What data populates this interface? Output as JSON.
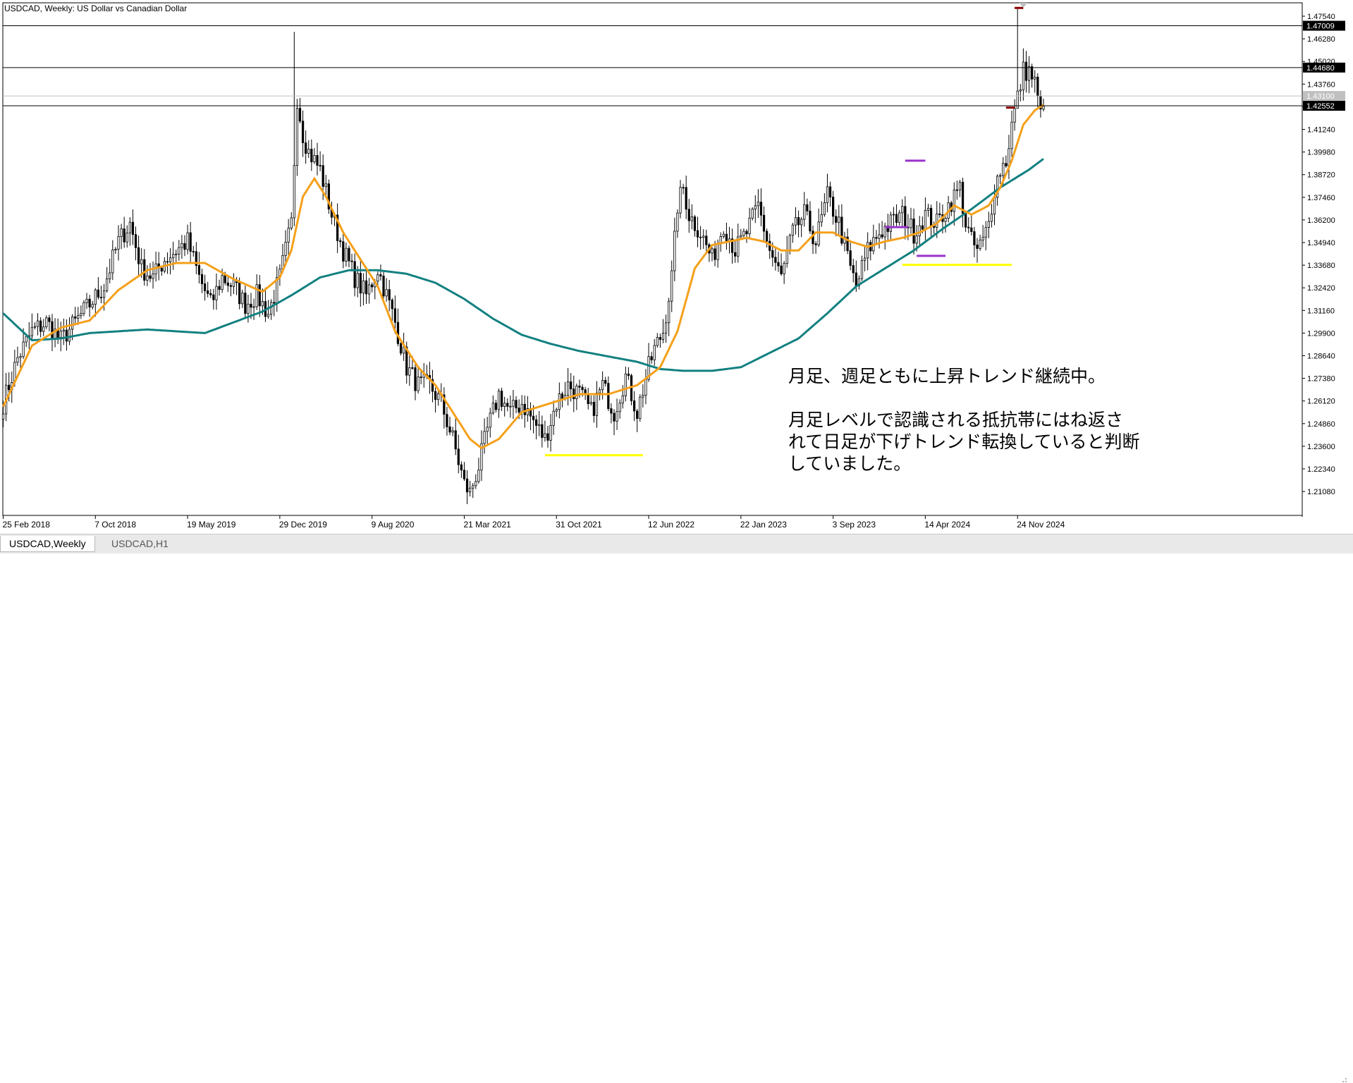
{
  "window": {
    "title": "USDCAD, Weekly:  US Dollar vs Canadian Dollar"
  },
  "tabs": [
    {
      "label": "USDCAD,Weekly",
      "active": true
    },
    {
      "label": "USDCAD,H1",
      "active": false
    }
  ],
  "annotation": {
    "line1": "月足、週足ともに上昇トレンド継続中。",
    "line2": "月足レベルで認識される抵抗帯にはね返さ",
    "line3": "れて日足が下げトレンド転換していると判断",
    "line4": "していました。"
  },
  "colors": {
    "bull_bear_candles": "#000000",
    "ma_fast": "#f5a01a",
    "ma_slow": "#128080",
    "marker_yellow": "#ffff00",
    "marker_purple": "#9932cc",
    "marker_darkred": "#8b0000",
    "price_label_bg": "#000000",
    "current_price_label_bg": "#c0c0c0"
  },
  "chart_data": {
    "type": "candlestick",
    "symbol": "USDCAD",
    "timeframe": "Weekly",
    "ylim": [
      1.1975,
      1.48285
    ],
    "y_ticks": [
      "1.47540",
      "1.46280",
      "1.45020",
      "1.43760",
      "1.42500",
      "1.41240",
      "1.39980",
      "1.38720",
      "1.37460",
      "1.36200",
      "1.34940",
      "1.33680",
      "1.32420",
      "1.31160",
      "1.29900",
      "1.28640",
      "1.27380",
      "1.26120",
      "1.24860",
      "1.23600",
      "1.22340",
      "1.21080"
    ],
    "x_ticks": [
      "25 Feb 2018",
      "7 Oct 2018",
      "19 May 2019",
      "29 Dec 2019",
      "9 Aug 2020",
      "21 Mar 2021",
      "31 Oct 2021",
      "12 Jun 2022",
      "22 Jan 2023",
      "3 Sep 2023",
      "14 Apr 2024",
      "24 Nov 2024"
    ],
    "x_tick_index": [
      0,
      32,
      64,
      96,
      128,
      160,
      192,
      224,
      256,
      288,
      320,
      352
    ],
    "n_bars": 362,
    "horizontal_lines": [
      {
        "price": 1.47009,
        "label": "1.47009"
      },
      {
        "price": 1.4468,
        "label": "1.44680"
      },
      {
        "price": 1.42552,
        "label": "1.42552"
      }
    ],
    "current_price": {
      "price": 1.431,
      "label": "1.43100"
    },
    "keypoints_close": [
      [
        0,
        1.26
      ],
      [
        5,
        1.285
      ],
      [
        10,
        1.3
      ],
      [
        15,
        1.305
      ],
      [
        20,
        1.295
      ],
      [
        25,
        1.305
      ],
      [
        30,
        1.315
      ],
      [
        35,
        1.325
      ],
      [
        40,
        1.35
      ],
      [
        44,
        1.36
      ],
      [
        48,
        1.335
      ],
      [
        52,
        1.33
      ],
      [
        56,
        1.34
      ],
      [
        60,
        1.345
      ],
      [
        64,
        1.35
      ],
      [
        68,
        1.33
      ],
      [
        72,
        1.315
      ],
      [
        76,
        1.33
      ],
      [
        80,
        1.325
      ],
      [
        84,
        1.315
      ],
      [
        88,
        1.32
      ],
      [
        92,
        1.31
      ],
      [
        96,
        1.33
      ],
      [
        98,
        1.345
      ],
      [
        100,
        1.36
      ],
      [
        102,
        1.43
      ],
      [
        104,
        1.41
      ],
      [
        106,
        1.4
      ],
      [
        110,
        1.39
      ],
      [
        114,
        1.365
      ],
      [
        118,
        1.345
      ],
      [
        122,
        1.33
      ],
      [
        126,
        1.32
      ],
      [
        130,
        1.335
      ],
      [
        134,
        1.315
      ],
      [
        136,
        1.305
      ],
      [
        140,
        1.28
      ],
      [
        144,
        1.27
      ],
      [
        148,
        1.27
      ],
      [
        152,
        1.26
      ],
      [
        156,
        1.24
      ],
      [
        160,
        1.215
      ],
      [
        162,
        1.21
      ],
      [
        165,
        1.225
      ],
      [
        168,
        1.245
      ],
      [
        172,
        1.265
      ],
      [
        176,
        1.255
      ],
      [
        180,
        1.26
      ],
      [
        184,
        1.25
      ],
      [
        188,
        1.24
      ],
      [
        192,
        1.26
      ],
      [
        196,
        1.27
      ],
      [
        200,
        1.265
      ],
      [
        204,
        1.255
      ],
      [
        208,
        1.27
      ],
      [
        212,
        1.255
      ],
      [
        216,
        1.275
      ],
      [
        220,
        1.255
      ],
      [
        224,
        1.28
      ],
      [
        226,
        1.29
      ],
      [
        229,
        1.3
      ],
      [
        232,
        1.33
      ],
      [
        234,
        1.37
      ],
      [
        236,
        1.38
      ],
      [
        238,
        1.365
      ],
      [
        242,
        1.355
      ],
      [
        246,
        1.34
      ],
      [
        250,
        1.36
      ],
      [
        254,
        1.345
      ],
      [
        258,
        1.355
      ],
      [
        262,
        1.37
      ],
      [
        266,
        1.345
      ],
      [
        270,
        1.33
      ],
      [
        274,
        1.355
      ],
      [
        278,
        1.365
      ],
      [
        282,
        1.35
      ],
      [
        286,
        1.375
      ],
      [
        290,
        1.36
      ],
      [
        294,
        1.335
      ],
      [
        296,
        1.325
      ],
      [
        300,
        1.345
      ],
      [
        304,
        1.355
      ],
      [
        308,
        1.36
      ],
      [
        312,
        1.365
      ],
      [
        316,
        1.355
      ],
      [
        320,
        1.365
      ],
      [
        324,
        1.36
      ],
      [
        328,
        1.37
      ],
      [
        332,
        1.38
      ],
      [
        334,
        1.36
      ],
      [
        336,
        1.35
      ],
      [
        338,
        1.345
      ],
      [
        340,
        1.35
      ],
      [
        342,
        1.36
      ],
      [
        344,
        1.38
      ],
      [
        346,
        1.39
      ],
      [
        348,
        1.395
      ],
      [
        350,
        1.415
      ],
      [
        352,
        1.43
      ],
      [
        354,
        1.445
      ],
      [
        356,
        1.445
      ],
      [
        358,
        1.438
      ],
      [
        360,
        1.42
      ],
      [
        361,
        1.43
      ]
    ],
    "ma_fast_keypoints": [
      [
        0,
        1.258
      ],
      [
        10,
        1.292
      ],
      [
        20,
        1.302
      ],
      [
        30,
        1.306
      ],
      [
        40,
        1.323
      ],
      [
        50,
        1.334
      ],
      [
        60,
        1.338
      ],
      [
        70,
        1.338
      ],
      [
        80,
        1.329
      ],
      [
        90,
        1.322
      ],
      [
        96,
        1.33
      ],
      [
        100,
        1.345
      ],
      [
        104,
        1.375
      ],
      [
        108,
        1.385
      ],
      [
        112,
        1.375
      ],
      [
        118,
        1.355
      ],
      [
        124,
        1.34
      ],
      [
        130,
        1.325
      ],
      [
        136,
        1.3
      ],
      [
        144,
        1.28
      ],
      [
        150,
        1.27
      ],
      [
        156,
        1.255
      ],
      [
        162,
        1.24
      ],
      [
        166,
        1.235
      ],
      [
        172,
        1.24
      ],
      [
        180,
        1.255
      ],
      [
        190,
        1.26
      ],
      [
        200,
        1.265
      ],
      [
        210,
        1.265
      ],
      [
        220,
        1.27
      ],
      [
        228,
        1.28
      ],
      [
        234,
        1.3
      ],
      [
        240,
        1.335
      ],
      [
        246,
        1.348
      ],
      [
        252,
        1.35
      ],
      [
        258,
        1.352
      ],
      [
        264,
        1.35
      ],
      [
        270,
        1.345
      ],
      [
        276,
        1.345
      ],
      [
        282,
        1.355
      ],
      [
        288,
        1.355
      ],
      [
        294,
        1.35
      ],
      [
        300,
        1.347
      ],
      [
        306,
        1.35
      ],
      [
        312,
        1.352
      ],
      [
        318,
        1.355
      ],
      [
        324,
        1.36
      ],
      [
        330,
        1.37
      ],
      [
        336,
        1.365
      ],
      [
        342,
        1.37
      ],
      [
        346,
        1.38
      ],
      [
        350,
        1.395
      ],
      [
        354,
        1.415
      ],
      [
        358,
        1.423
      ],
      [
        361,
        1.426
      ]
    ],
    "ma_slow_keypoints": [
      [
        0,
        1.31
      ],
      [
        10,
        1.295
      ],
      [
        20,
        1.296
      ],
      [
        30,
        1.299
      ],
      [
        40,
        1.3
      ],
      [
        50,
        1.301
      ],
      [
        60,
        1.3
      ],
      [
        70,
        1.299
      ],
      [
        80,
        1.305
      ],
      [
        90,
        1.311
      ],
      [
        100,
        1.32
      ],
      [
        110,
        1.33
      ],
      [
        120,
        1.334
      ],
      [
        130,
        1.334
      ],
      [
        140,
        1.332
      ],
      [
        150,
        1.327
      ],
      [
        160,
        1.318
      ],
      [
        170,
        1.307
      ],
      [
        180,
        1.298
      ],
      [
        190,
        1.293
      ],
      [
        200,
        1.289
      ],
      [
        210,
        1.286
      ],
      [
        220,
        1.283
      ],
      [
        228,
        1.279
      ],
      [
        236,
        1.278
      ],
      [
        246,
        1.278
      ],
      [
        256,
        1.28
      ],
      [
        266,
        1.288
      ],
      [
        276,
        1.296
      ],
      [
        286,
        1.31
      ],
      [
        296,
        1.325
      ],
      [
        306,
        1.335
      ],
      [
        316,
        1.345
      ],
      [
        326,
        1.357
      ],
      [
        336,
        1.368
      ],
      [
        346,
        1.38
      ],
      [
        356,
        1.39
      ],
      [
        361,
        1.396
      ]
    ],
    "markers": [
      {
        "color": "yellow",
        "price": 1.337,
        "from": 312,
        "to": 350
      },
      {
        "color": "yellow",
        "price": 1.231,
        "from": 188,
        "to": 222
      },
      {
        "color": "purple",
        "price": 1.395,
        "from": 313,
        "to": 320
      },
      {
        "color": "purple",
        "price": 1.358,
        "from": 306,
        "to": 314
      },
      {
        "color": "purple",
        "price": 1.342,
        "from": 317,
        "to": 327
      },
      {
        "color": "darkred",
        "price": 1.48,
        "from": 351,
        "to": 354
      },
      {
        "color": "darkred",
        "price": 1.4245,
        "from": 348,
        "to": 351
      }
    ],
    "special_wicks": [
      {
        "i": 101,
        "high": 1.4667
      },
      {
        "i": 352,
        "high": 1.4793,
        "low": 1.424
      }
    ]
  }
}
